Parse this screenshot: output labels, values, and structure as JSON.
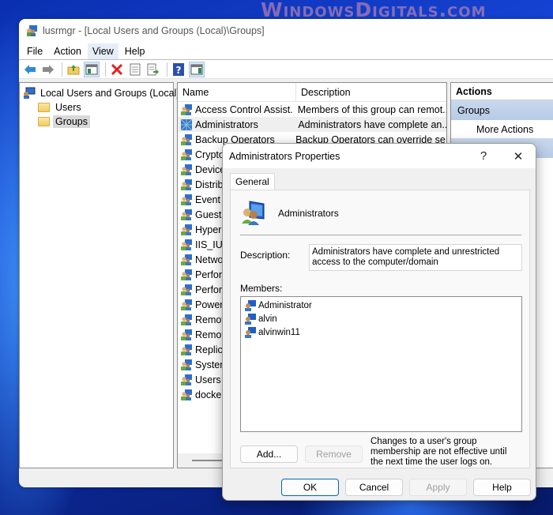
{
  "watermark": "WindowsDigitals.com",
  "window": {
    "title": "lusrmgr - [Local Users and Groups (Local)\\Groups]",
    "menu": [
      "File",
      "Action",
      "View",
      "Help"
    ],
    "active_menu": "View",
    "toolbar": [
      "back-icon",
      "forward-icon",
      "up-folder-icon",
      "show-hide-console-tree-icon",
      "delete-icon",
      "properties-icon",
      "export-list-icon",
      "help-icon",
      "show-hide-action-pane-icon"
    ]
  },
  "tree": {
    "root": "Local Users and Groups (Local)",
    "children": [
      "Users",
      "Groups"
    ],
    "selected": "Groups"
  },
  "list": {
    "columns": [
      "Name",
      "Description"
    ],
    "rows": [
      {
        "name": "Access Control Assist...",
        "desc": "Members of this group can remot..."
      },
      {
        "name": "Administrators",
        "desc": "Administrators have complete an..."
      },
      {
        "name": "Backup Operators",
        "desc": "Backup Operators can override se..."
      },
      {
        "name": "Crypto",
        "desc": ""
      },
      {
        "name": "Device",
        "desc": ""
      },
      {
        "name": "Distrib",
        "desc": ""
      },
      {
        "name": "Event l",
        "desc": ""
      },
      {
        "name": "Guests",
        "desc": ""
      },
      {
        "name": "Hyper-",
        "desc": ""
      },
      {
        "name": "IIS_IUS",
        "desc": ""
      },
      {
        "name": "Netwo",
        "desc": ""
      },
      {
        "name": "Perfori",
        "desc": ""
      },
      {
        "name": "Perfori",
        "desc": ""
      },
      {
        "name": "Power",
        "desc": ""
      },
      {
        "name": "Remot",
        "desc": ""
      },
      {
        "name": "Remot",
        "desc": ""
      },
      {
        "name": "Replica",
        "desc": ""
      },
      {
        "name": "System",
        "desc": ""
      },
      {
        "name": "Users",
        "desc": ""
      },
      {
        "name": "docker",
        "desc": ""
      }
    ]
  },
  "actions": {
    "title": "Actions",
    "group": "Groups",
    "items": [
      "More Actions"
    ]
  },
  "dialog": {
    "title": "Administrators Properties",
    "help_btn": "?",
    "close_btn": "✕",
    "tab": "General",
    "group_name": "Administrators",
    "description_label": "Description:",
    "description": "Administrators have complete and unrestricted access to the computer/domain",
    "members_label": "Members:",
    "members": [
      "Administrator",
      "alvin",
      "alvinwin11"
    ],
    "add_btn": "Add...",
    "remove_btn": "Remove",
    "note": "Changes to a user's group membership are not effective until the next time the user logs on.",
    "ok_btn": "OK",
    "cancel_btn": "Cancel",
    "apply_btn": "Apply",
    "help_button": "Help"
  }
}
